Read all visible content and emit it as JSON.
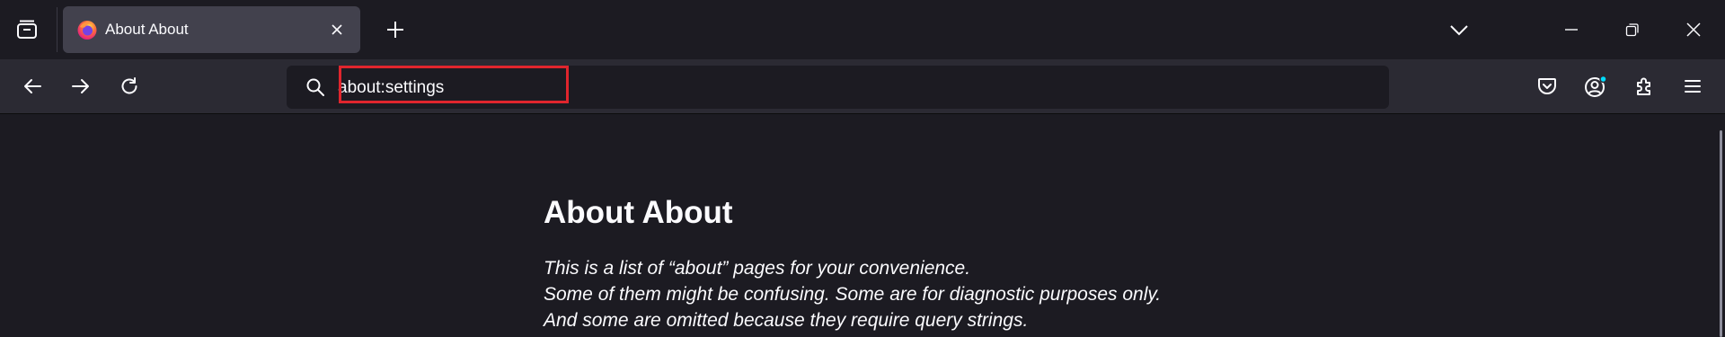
{
  "browser": {
    "tab": {
      "title": "About About",
      "favicon": "firefox-logo-icon"
    },
    "url": "about:settings",
    "icons": {
      "tab_list": "tab-list-icon",
      "new_tab": "plus-icon",
      "list_all_tabs": "chevron-down-icon",
      "minimize": "minimize-icon",
      "restore": "restore-icon",
      "close": "close-icon",
      "back": "back-arrow-icon",
      "forward": "forward-arrow-icon",
      "reload": "reload-icon",
      "search": "search-icon",
      "pocket": "pocket-icon",
      "account": "account-icon",
      "extensions": "extensions-icon",
      "menu": "hamburger-menu-icon"
    },
    "colors": {
      "highlight": "#e0252d",
      "account_badge": "#00ddff"
    }
  },
  "page": {
    "title": "About About",
    "intro_lines": [
      "This is a list of “about” pages for your convenience.",
      "Some of them might be confusing. Some are for diagnostic purposes only.",
      "And some are omitted because they require query strings."
    ]
  }
}
